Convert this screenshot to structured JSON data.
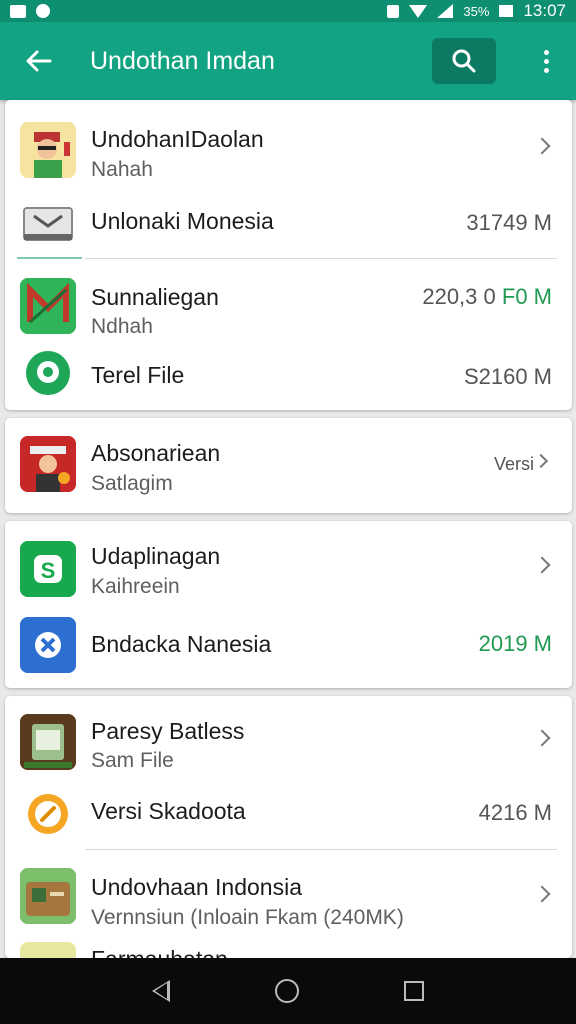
{
  "status_bar": {
    "battery_pct": "35%",
    "time": "13:07"
  },
  "app_bar": {
    "title": "Undothan Imdan"
  },
  "cards": [
    {
      "rows": [
        {
          "title": "UndohanIDaolan",
          "subtitle": "Nahah",
          "chevron": true
        },
        {
          "title": "Unlonaki Monesia",
          "size": "31749 M"
        },
        {
          "title": "Sunnaliegan",
          "subtitle": "Ndhah",
          "size_prefix": "220,3 0",
          "size": "F0 M"
        },
        {
          "title": "Terel File",
          "size": "S2160 M"
        }
      ]
    },
    {
      "rows": [
        {
          "title": "Absonariean",
          "subtitle": "Satlagim",
          "size": "Versi"
        }
      ]
    },
    {
      "rows": [
        {
          "title": "Udaplinagan",
          "subtitle": "Kaihreein",
          "chevron": true
        },
        {
          "title": "Bndacka Nanesia",
          "size": "2019 M"
        }
      ]
    },
    {
      "rows": [
        {
          "title": "Paresy Batless",
          "subtitle": "Sam File",
          "chevron": true
        },
        {
          "title": "Versi Skadoota",
          "size": "4216 M"
        },
        {
          "title": "Undovhaan Indonsia",
          "subtitle": "Vernnsiun (Inloain Fkam (240MK)",
          "chevron": true
        },
        {
          "title": "Farmauhatan"
        }
      ]
    }
  ],
  "colors": {
    "primary": "#12a382",
    "status": "#0f8f72",
    "green_text": "#1f9a52"
  },
  "icons": [
    "back-arrow-icon",
    "search-icon",
    "more-vert-icon",
    "chevron-right-icon",
    "nav-back-icon",
    "nav-home-icon",
    "nav-recent-icon"
  ]
}
